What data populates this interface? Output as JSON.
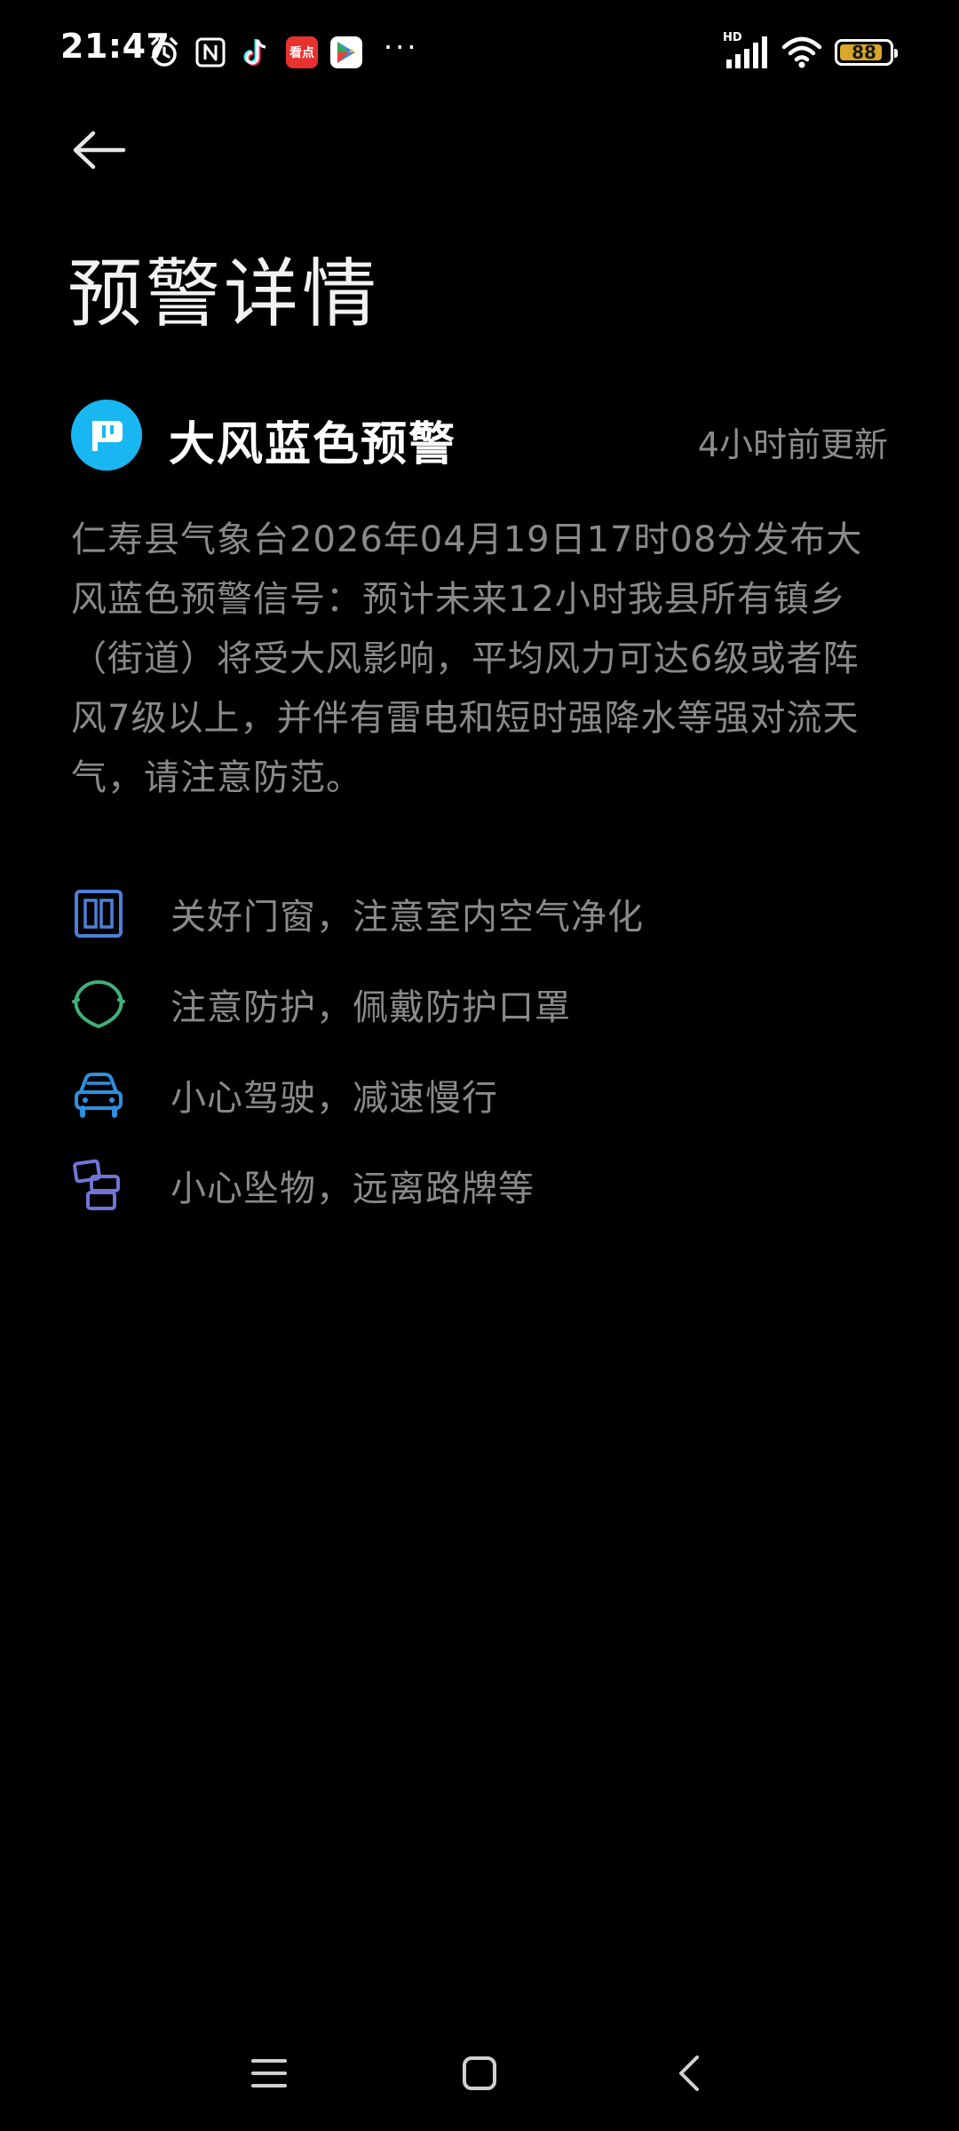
{
  "status_bar": {
    "time": "21:47",
    "dots": "···",
    "app_badge_label": "看点",
    "network_label": "HD",
    "battery_level": 88,
    "battery_text": "88",
    "battery_color": "#d9a72a"
  },
  "page": {
    "title": "预警详情"
  },
  "alert": {
    "title": "大风蓝色预警",
    "updated": "4小时前更新",
    "logo_color": "#19b7f2",
    "description": "仁寿县气象台2026年04月19日17时08分发布大风蓝色预警信号：预计未来12小时我县所有镇乡（街道）将受大风影响，平均风力可达6级或者阵风7级以上，并伴有雷电和短时强降水等强对流天气，请注意防范。"
  },
  "tips": [
    {
      "icon": "window-icon",
      "text": "关好门窗，注意室内空气净化",
      "color": "#4f7fd6"
    },
    {
      "icon": "mask-icon",
      "text": "注意防护，佩戴防护口罩",
      "color": "#3fb07a"
    },
    {
      "icon": "car-icon",
      "text": "小心驾驶，减速慢行",
      "color": "#2f8fe0"
    },
    {
      "icon": "falling-objects-icon",
      "text": "小心坠物，远离路牌等",
      "color": "#6f74d6"
    }
  ]
}
